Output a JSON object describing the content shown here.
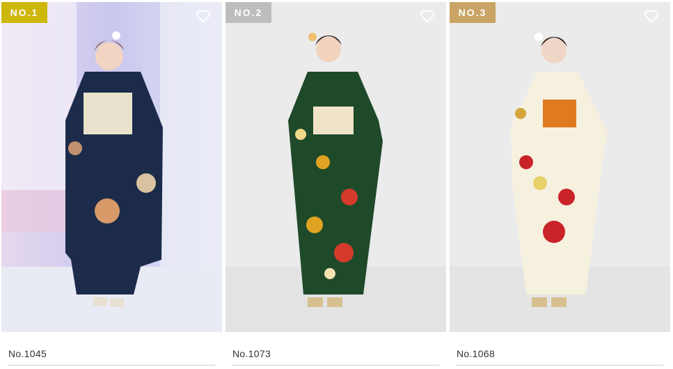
{
  "products": [
    {
      "rank": "NO.1",
      "number": "No.1045",
      "badge_color": "#cdb70b",
      "kimono": "navy"
    },
    {
      "rank": "NO.2",
      "number": "No.1073",
      "badge_color": "#bdbdbd",
      "kimono": "green"
    },
    {
      "rank": "NO.3",
      "number": "No.1068",
      "badge_color": "#c9a465",
      "kimono": "cream"
    }
  ],
  "icons": {
    "favorite": "heart-outline-icon"
  }
}
